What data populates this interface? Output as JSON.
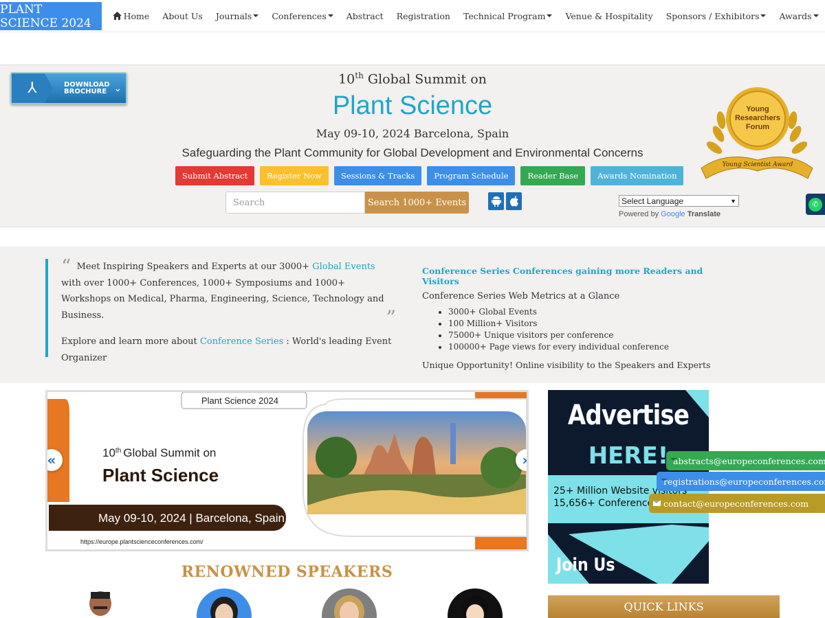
{
  "nav": {
    "brand": "PLANT SCIENCE 2024",
    "items": [
      {
        "label": "Home",
        "dropdown": false
      },
      {
        "label": "About Us",
        "dropdown": false
      },
      {
        "label": "Journals",
        "dropdown": true
      },
      {
        "label": "Conferences",
        "dropdown": true
      },
      {
        "label": "Abstract",
        "dropdown": false
      },
      {
        "label": "Registration",
        "dropdown": false
      },
      {
        "label": "Technical Program",
        "dropdown": true
      },
      {
        "label": "Venue & Hospitality",
        "dropdown": false
      },
      {
        "label": "Sponsors / Exhibitors",
        "dropdown": true
      },
      {
        "label": "Awards",
        "dropdown": true
      }
    ]
  },
  "hero": {
    "brochure_line1": "DOWNLOAD",
    "brochure_line2": "BROCHURE",
    "summit_ordinal": "10",
    "summit_suffix": "th",
    "summit_text": "Global Summit on",
    "title": "Plant Science",
    "dateline": "May 09-10, 2024 Barcelona, Spain",
    "theme": "Safeguarding the Plant Community for Global Development and Environmental Concerns",
    "buttons": [
      {
        "label": "Submit Abstract",
        "color": "#e53935"
      },
      {
        "label": "Register Now",
        "color": "#fbc02d"
      },
      {
        "label": "Sessions & Tracks",
        "color": "#3d8ee9"
      },
      {
        "label": "Program Schedule",
        "color": "#3d8ee9"
      },
      {
        "label": "Reader Base",
        "color": "#34a853"
      },
      {
        "label": "Awards Nomination",
        "color": "#4fb3d9"
      }
    ],
    "search_placeholder": "Search",
    "search_button": "Search 1000+ Events",
    "language_select": "Select Language",
    "powered_by": "Powered by",
    "google": "Google",
    "translate": "Translate",
    "award_line1": "Young",
    "award_line2": "Researchers",
    "award_line3": "Forum",
    "award_ribbon": "Young Scientist Award"
  },
  "info": {
    "quote_pre": "Meet Inspiring Speakers and Experts at our 3000+",
    "quote_link": "Global Events",
    "quote_post": "with over 1000+ Conferences, 1000+ Symposiums and 1000+ Workshops on Medical, Pharma, Engineering, Science, Technology and Business.",
    "explore_pre": "Explore and learn more about",
    "explore_link": "Conference Series",
    "explore_post": ": World's leading Event Organizer",
    "metrics_title": "Conference Series Conferences gaining more Readers and Visitors",
    "metrics_sub": "Conference Series Web Metrics at a Glance",
    "metrics_items": [
      "3000+ Global Events",
      "100 Million+ Visitors",
      "75000+ Unique visitors per conference",
      "100000+ Page views for every individual conference"
    ],
    "metrics_opportunity": "Unique Opportunity! Online visibility to the Speakers and Experts"
  },
  "carousel": {
    "tag": "Plant Science 2024",
    "summit_ordinal": "10",
    "summit_suffix": "th",
    "summit_text": "Global Summit on",
    "title": "Plant Science",
    "dateline": "May 09-10, 2024 | Barcelona, Spain",
    "url": "https://europe.plantscienceconferences.com/"
  },
  "renowned_title": "RENOWNED SPEAKERS",
  "advert": {
    "title": "Advertise",
    "here": "HERE!",
    "stat1": "25+ Million Website visitors",
    "stat2": "15,656+ Conferences",
    "join": "Join Us"
  },
  "quick_links": "QUICK LINKS",
  "contacts": [
    {
      "email": "abstracts@europeconferences.com",
      "color": "#34a853"
    },
    {
      "email": "registrations@europeconferences.com",
      "color": "#3d8ee9"
    },
    {
      "email": "contact@europeconferences.com",
      "color": "#b89a26"
    }
  ]
}
